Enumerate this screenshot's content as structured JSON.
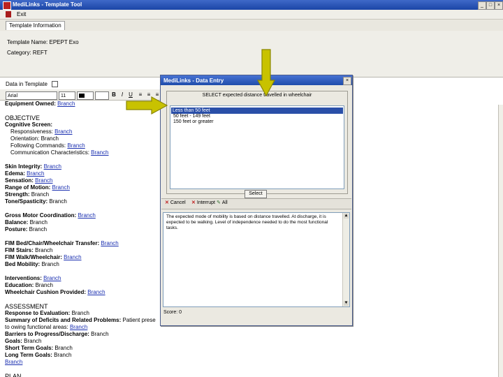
{
  "window": {
    "title": "MediLinks - Template Tool"
  },
  "menu": {
    "items": [
      "Exit"
    ]
  },
  "tabs": [
    "Template Information"
  ],
  "template_info": {
    "name_label": "Template Name:",
    "name_value": "EPEPT Exo",
    "category_label": "Category:",
    "category_value": "REFT"
  },
  "dt_toggle_label": "Data in Template",
  "format": {
    "font": "Arial",
    "size": "11"
  },
  "editor": {
    "lines": [
      [
        {
          "t": "Equipment Owned: ",
          "s": "b"
        },
        {
          "t": "Branch",
          "s": "lk"
        }
      ],
      [],
      [
        {
          "t": "OBJECTIVE",
          "s": "h"
        }
      ],
      [
        {
          "t": "Cognitive Screen:",
          "s": "b"
        }
      ],
      [
        {
          "t": "Responsiveness: ",
          "s": ""
        },
        {
          "t": "Branch",
          "s": "lk"
        }
      ],
      [
        {
          "t": "Orientation: Branch",
          "s": ""
        }
      ],
      [
        {
          "t": "Following Commands: ",
          "s": ""
        },
        {
          "t": "Branch",
          "s": "lk"
        }
      ],
      [
        {
          "t": "Communication Characteristics: ",
          "s": ""
        },
        {
          "t": "Branch",
          "s": "lk"
        }
      ],
      [],
      [
        {
          "t": "Skin Integrity: ",
          "s": "b"
        },
        {
          "t": "Branch",
          "s": "lk"
        }
      ],
      [
        {
          "t": "Edema: ",
          "s": "b"
        },
        {
          "t": "Branch",
          "s": "lk"
        }
      ],
      [
        {
          "t": "Sensation: ",
          "s": "b"
        },
        {
          "t": "Branch",
          "s": "lk"
        }
      ],
      [
        {
          "t": "Range of Motion: ",
          "s": "b"
        },
        {
          "t": "Branch",
          "s": "lk"
        }
      ],
      [
        {
          "t": "Strength: ",
          "s": "b"
        },
        {
          "t": "Branch",
          "s": ""
        }
      ],
      [
        {
          "t": "Tone/Spasticity: ",
          "s": "b"
        },
        {
          "t": "Branch",
          "s": ""
        }
      ],
      [],
      [
        {
          "t": "Gross Motor Coordination: ",
          "s": "b"
        },
        {
          "t": "Branch",
          "s": "lk"
        }
      ],
      [
        {
          "t": "Balance: ",
          "s": "b"
        },
        {
          "t": "Branch",
          "s": ""
        }
      ],
      [
        {
          "t": "Posture: ",
          "s": "b"
        },
        {
          "t": "Branch",
          "s": ""
        }
      ],
      [],
      [
        {
          "t": "FIM Bed/Chair/Wheelchair Transfer: ",
          "s": "b"
        },
        {
          "t": "Branch",
          "s": "lk"
        }
      ],
      [
        {
          "t": "FIM Stairs: ",
          "s": "b"
        },
        {
          "t": "Branch",
          "s": ""
        }
      ],
      [
        {
          "t": "FIM Walk/Wheelchair: ",
          "s": "b"
        },
        {
          "t": "Branch",
          "s": "lk"
        }
      ],
      [
        {
          "t": "Bed Mobility: ",
          "s": "b"
        },
        {
          "t": "Branch",
          "s": ""
        }
      ],
      [],
      [
        {
          "t": "Interventions: ",
          "s": "b"
        },
        {
          "t": "Branch",
          "s": "lk"
        }
      ],
      [
        {
          "t": "Education: ",
          "s": "b"
        },
        {
          "t": "Branch",
          "s": ""
        }
      ],
      [
        {
          "t": "Wheelchair Cushion Provided: ",
          "s": "b"
        },
        {
          "t": "Branch",
          "s": "lk"
        }
      ],
      [],
      [
        {
          "t": "ASSESSMENT",
          "s": "h"
        }
      ],
      [
        {
          "t": "Response to Evaluation: ",
          "s": "b"
        },
        {
          "t": "Branch",
          "s": ""
        }
      ],
      [
        {
          "t": "Summary of Deficits and Related Problems: ",
          "s": "b"
        },
        {
          "t": "Patient prese",
          "s": ""
        }
      ],
      [
        {
          "t": "to owing functional areas: ",
          "s": ""
        },
        {
          "t": "Branch",
          "s": "lk"
        }
      ],
      [
        {
          "t": "Barriers to Progress/Discharge: ",
          "s": "b"
        },
        {
          "t": "Branch",
          "s": ""
        }
      ],
      [
        {
          "t": "Goals: ",
          "s": "b"
        },
        {
          "t": "Branch",
          "s": ""
        }
      ],
      [
        {
          "t": "Short Term Goals: ",
          "s": "b"
        },
        {
          "t": "Branch",
          "s": ""
        }
      ],
      [
        {
          "t": "Long Term Goals: ",
          "s": "b"
        },
        {
          "t": "Branch",
          "s": ""
        }
      ],
      [
        {
          "t": "Branch",
          "s": "lk"
        }
      ],
      [],
      [
        {
          "t": "PLAN",
          "s": "h"
        }
      ]
    ],
    "indented": [
      4,
      5,
      6,
      7
    ]
  },
  "dialog": {
    "title": "MediLinks - Data Entry",
    "prompt": "SELECT expected distance travelled in wheelchair",
    "options": [
      "Less than 50 feet",
      "50 feet - 149 feet",
      "150 feet or greater"
    ],
    "selected_index": 0,
    "select_label": "Select",
    "cancel_label": "Cancel",
    "interrupt_label": "Interrupt",
    "extra_label": "All",
    "result_text": "The expected mode of mobility is based on distance travelled. At discharge, it is expected to be walking. Level of independence needed to do the most functional tasks.",
    "status": "Score: 0"
  },
  "colors": {
    "titlebar": "#1b45a6",
    "link": "#1a2fb0",
    "selection": "#2a4fa8",
    "arrow": "#c8c200"
  }
}
